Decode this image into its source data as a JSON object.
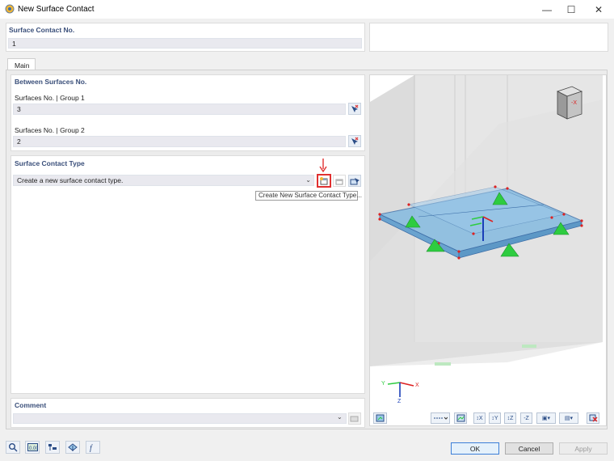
{
  "window": {
    "title": "New Surface Contact",
    "minimize_glyph": "—",
    "maximize_glyph": "☐",
    "close_glyph": "✕"
  },
  "header": {
    "contact_no_label": "Surface Contact No.",
    "contact_no_value": "1"
  },
  "tabs": [
    {
      "label": "Main"
    }
  ],
  "between": {
    "heading": "Between Surfaces No.",
    "group1_label": "Surfaces No. | Group 1",
    "group1_value": "3",
    "group2_label": "Surfaces No. | Group 2",
    "group2_value": "2"
  },
  "contact_type": {
    "heading": "Surface Contact Type",
    "selected": "Create a new surface contact type.",
    "tooltip": "Create New Surface Contact Type..."
  },
  "comment": {
    "label": "Comment",
    "value": ""
  },
  "viewport": {
    "axes": {
      "x": "X",
      "y": "Y",
      "z": "Z"
    },
    "cube_label": "-X"
  },
  "buttons": {
    "ok": "OK",
    "cancel": "Cancel",
    "apply": "Apply"
  },
  "icons": [
    "search-icon",
    "units-icon",
    "structure-icon",
    "info-icon",
    "formula-icon",
    "new-item-icon",
    "edit-item-icon",
    "select-in-graphic-icon",
    "pick-icon",
    "view-x-icon",
    "view-y-icon",
    "view-z-icon",
    "view-minus-z-icon",
    "reset-icon"
  ],
  "colors": {
    "accent_heading": "#3a4f7a",
    "highlight_red": "#e03030",
    "support_green": "#2ecc40",
    "surface_blue": "#7fb8e0"
  }
}
